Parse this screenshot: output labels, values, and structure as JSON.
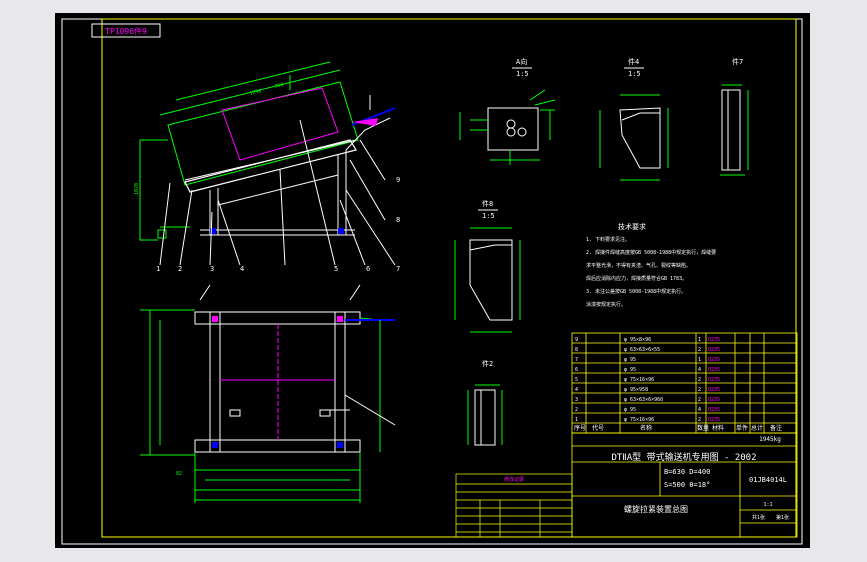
{
  "drawing": {
    "stamp": "TP1096件9",
    "title_line": "DTⅡA型  带式输送机专用图 - 2002",
    "spec_line1": "B=630 D=400",
    "spec_line2": "S=500 θ=18°",
    "drawing_no": "01JB4014L",
    "part_name": "螺旋拉紧装置总图",
    "weight": "1945kg",
    "ratio": "1:1",
    "sheets": "共1张",
    "sheet_no": "第1张"
  },
  "views": {
    "a": {
      "title": "A向",
      "scale": "1:5"
    },
    "p4": {
      "title": "件4",
      "scale": "1:5"
    },
    "p7": {
      "title": "件7"
    },
    "p8": {
      "title": "件8",
      "scale": "1:5"
    },
    "p2": {
      "title": "件2"
    }
  },
  "balloons": [
    "1",
    "2",
    "3",
    "4",
    "5",
    "6",
    "7",
    "8",
    "9"
  ],
  "notes": {
    "heading": "技术要求",
    "lines": [
      "1. 下料要求见注。",
      "2. 焊接件焊缝高度按GB 5008-1988中规定执行，焊缝要",
      "   求平整光滑，不得有夹渣、气孔、裂纹等缺陷。",
      "   焊后应消除内应力，焊接质量符合GB 1783。",
      "3. 未注公差按GB 5008-1988中规定执行。",
      "   涂漆按规定执行。"
    ]
  },
  "bom_header": [
    "序号",
    "代号",
    "名称",
    "数量",
    "材料",
    "单件",
    "总计",
    "备注"
  ],
  "bom_rows": [
    [
      "9",
      "",
      "φ 95×8×96",
      "1",
      "Q235",
      "",
      "",
      ""
    ],
    [
      "8",
      "",
      "φ 63×63×6×55",
      "2",
      "Q235",
      "",
      "",
      ""
    ],
    [
      "7",
      "",
      "φ 95",
      "1",
      "Q235",
      "",
      "",
      ""
    ],
    [
      "6",
      "",
      "φ 95",
      "4",
      "Q235",
      "",
      "",
      ""
    ],
    [
      "5",
      "",
      "φ 75×16×96",
      "2",
      "Q235",
      "",
      "",
      ""
    ],
    [
      "4",
      "",
      "φ 95×958",
      "2",
      "Q235",
      "",
      "",
      ""
    ],
    [
      "3",
      "",
      "φ 63×63×6×960",
      "2",
      "Q235",
      "",
      "",
      ""
    ],
    [
      "2",
      "",
      "φ 95",
      "4",
      "Q235",
      "",
      "",
      ""
    ],
    [
      "1",
      "",
      "φ 75×16×96",
      "2",
      "Q235",
      "",
      "",
      ""
    ]
  ],
  "revision_label": "修改记录",
  "colors": {
    "frame": "#ffffff",
    "structure": "#ffffff",
    "dimension": "#00ff00",
    "annotation": "#ff00ff",
    "table_line": "#ffff00",
    "hidden": "#0000ff",
    "canvas": "#000000"
  }
}
